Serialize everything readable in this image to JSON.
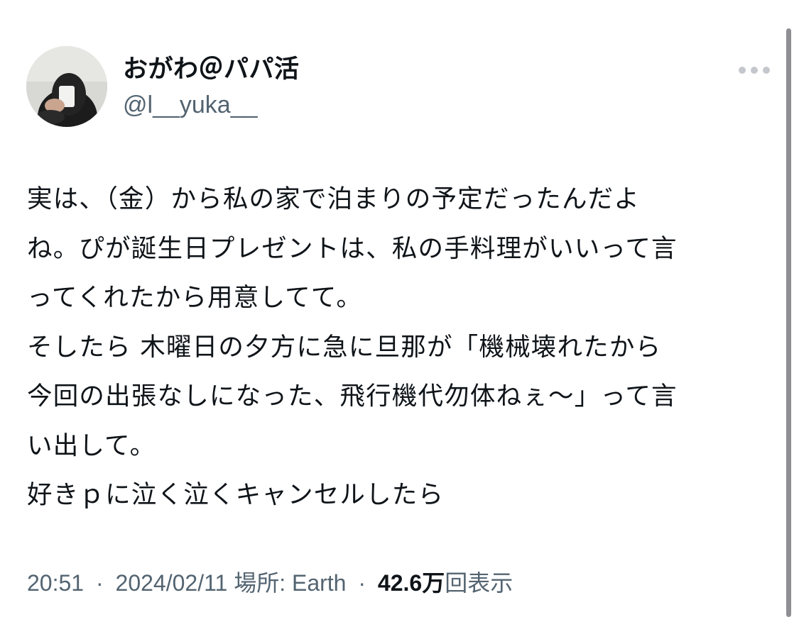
{
  "author": {
    "display_name": "おがわ＠パパ活",
    "handle": "@l__yuka__"
  },
  "icons": {
    "more": "more-horizontal-icon",
    "avatar": "avatar-photo"
  },
  "tweet": {
    "lines": [
      "実は、（金）から私の家で泊まりの予定だったんだよ",
      "ね。ぴが誕生日プレゼントは、私の手料理がいいって言",
      "ってくれたから用意してて。",
      "そしたら 木曜日の夕方に急に旦那が「機械壊れたから",
      "今回の出張なしになった、飛行機代勿体ねぇ〜」って言",
      "い出して。",
      "好きｐに泣く泣くキャンセルしたら"
    ]
  },
  "meta": {
    "time": "20:51",
    "separator": "·",
    "date": "2024/02/11",
    "location_label": "場所: Earth",
    "views_count": "42.6万",
    "views_label": "回表示"
  },
  "colors": {
    "text": "#0f1419",
    "secondary": "#536471",
    "more_dots": "#c4c8cc",
    "scrollbar": "#8e8e93"
  }
}
